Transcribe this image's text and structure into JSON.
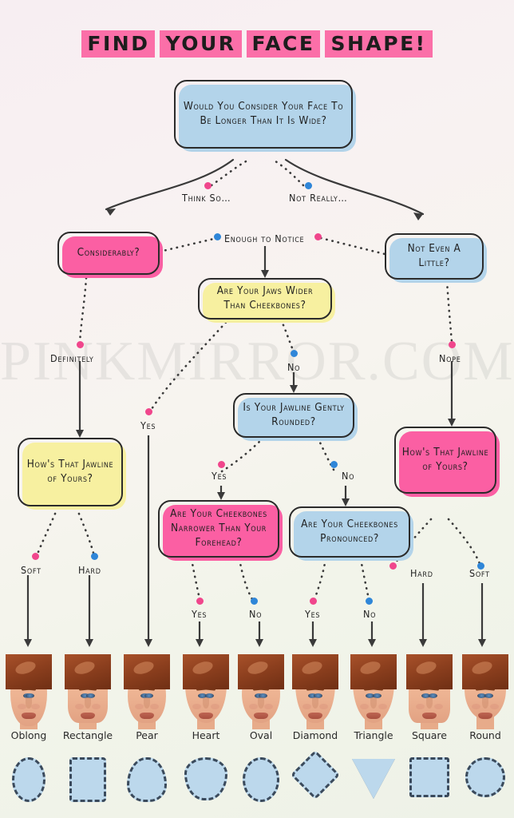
{
  "title": {
    "words": [
      "FIND",
      "YOUR",
      "FACE",
      "SHAPE!"
    ]
  },
  "watermark": "PINKMIRROR.COM",
  "colors": {
    "pink": "#fb5fa3",
    "blue": "#b3d4ea",
    "yellow": "#f7f0a0",
    "dot_pink": "#f0468c",
    "dot_blue": "#2f86d8",
    "outline": "#2b2b2b"
  },
  "boxes": [
    {
      "id": "q-longer",
      "color": "blue",
      "text": "Would You Consider Your Face To Be Longer Than It Is Wide?"
    },
    {
      "id": "q-considerably",
      "color": "pink",
      "text": "Considerably?"
    },
    {
      "id": "q-jaws-wider",
      "color": "yellow",
      "text": "Are Your Jaws Wider Than Cheekbones?"
    },
    {
      "id": "q-not-even",
      "color": "blue",
      "text": "Not Even A  Little?"
    },
    {
      "id": "q-jawline-rounded",
      "color": "blue",
      "text": "Is Your Jawline Gently Rounded?"
    },
    {
      "id": "q-jawline-left",
      "color": "yellow",
      "text": "How's That Jawline of Yours?"
    },
    {
      "id": "q-cheek-narrower",
      "color": "pink",
      "text": "Are Your Cheekbones Narrower Than Your Forehead?"
    },
    {
      "id": "q-cheek-pronounced",
      "color": "blue",
      "text": "Are Your Cheekbones Pronounced?"
    },
    {
      "id": "q-jawline-right",
      "color": "pink",
      "text": "How's That Jawline of Yours?"
    }
  ],
  "edge_labels": [
    {
      "id": "think-so",
      "text": "Think So…",
      "dot": "pink"
    },
    {
      "id": "not-really",
      "text": "Not Really…",
      "dot": "blue"
    },
    {
      "id": "enough-to-notice",
      "text": "Enough to Notice",
      "dot": "both"
    },
    {
      "id": "definitely",
      "text": "Definitely",
      "dot": "pink"
    },
    {
      "id": "nope",
      "text": "Nope",
      "dot": "pink"
    },
    {
      "id": "no-jaws",
      "text": "No",
      "dot": "blue"
    },
    {
      "id": "yes-jaws",
      "text": "Yes",
      "dot": "pink"
    },
    {
      "id": "yes-rounded",
      "text": "Yes",
      "dot": "pink"
    },
    {
      "id": "no-rounded",
      "text": "No",
      "dot": "blue"
    },
    {
      "id": "soft-left",
      "text": "Soft",
      "dot": "pink"
    },
    {
      "id": "hard-left",
      "text": "Hard",
      "dot": "blue"
    },
    {
      "id": "yes-narrower",
      "text": "Yes",
      "dot": "pink"
    },
    {
      "id": "no-narrower",
      "text": "No",
      "dot": "blue"
    },
    {
      "id": "yes-pronounced",
      "text": "Yes",
      "dot": "pink"
    },
    {
      "id": "no-pronounced",
      "text": "No",
      "dot": "blue"
    },
    {
      "id": "hard-right",
      "text": "Hard",
      "dot": "pink"
    },
    {
      "id": "soft-right",
      "text": "Soft",
      "dot": "blue"
    }
  ],
  "face_shapes": [
    {
      "name": "Oblong",
      "shape": "oblong"
    },
    {
      "name": "Rectangle",
      "shape": "rect"
    },
    {
      "name": "Pear",
      "shape": "pear"
    },
    {
      "name": "Heart",
      "shape": "heart"
    },
    {
      "name": "Oval",
      "shape": "oval"
    },
    {
      "name": "Diamond",
      "shape": "diamond"
    },
    {
      "name": "Triangle",
      "shape": "triangle"
    },
    {
      "name": "Square",
      "shape": "square"
    },
    {
      "name": "Round",
      "shape": "round"
    }
  ]
}
